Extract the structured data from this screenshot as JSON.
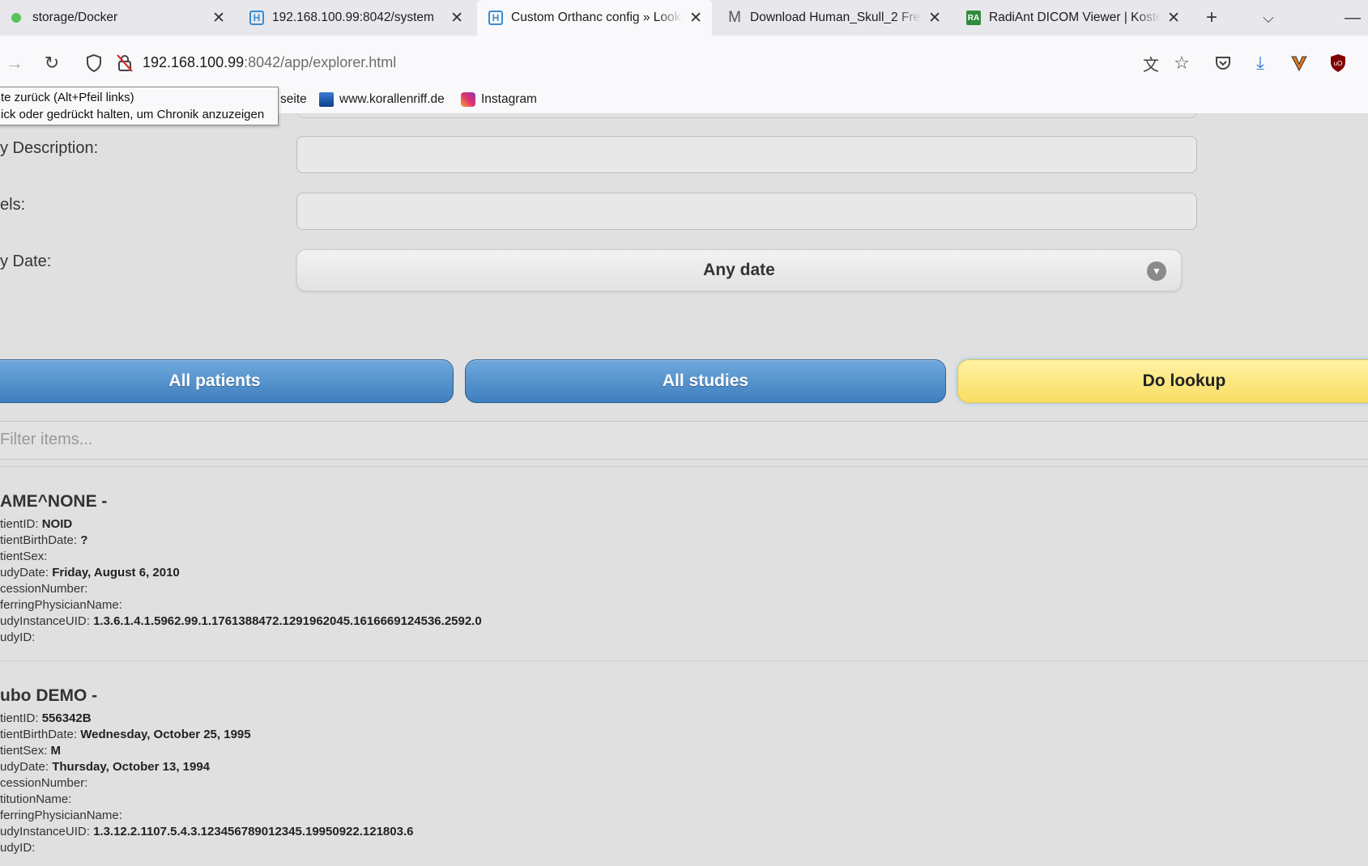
{
  "browser": {
    "tabs": [
      {
        "title": "storage/Docker",
        "favicon": "green-dot-icon"
      },
      {
        "title": "192.168.100.99:8042/system",
        "favicon": "orthanc-icon"
      },
      {
        "title": "Custom Orthanc config » Looku",
        "favicon": "orthanc-icon",
        "active": true
      },
      {
        "title": "Download Human_Skull_2 Free",
        "favicon": "m-icon"
      },
      {
        "title": "RadiAnt DICOM Viewer | Kosten",
        "favicon": "radiant-icon"
      }
    ],
    "url_host": "192.168.100.99",
    "url_rest": ":8042/app/explorer.html",
    "bookmarks": [
      {
        "label": "seite"
      },
      {
        "label": "www.korallenriff.de"
      },
      {
        "label": "Instagram"
      }
    ],
    "tooltip": {
      "line1": "te zurück (Alt+Pfeil links)",
      "line2": "ick oder gedrückt halten, um Chronik anzuzeigen"
    }
  },
  "form": {
    "description_label": "y Description:",
    "labels_label": "els:",
    "date_label": "y Date:",
    "date_value": "Any date"
  },
  "buttons": {
    "all_patients": "All patients",
    "all_studies": "All studies",
    "do_lookup": "Do lookup"
  },
  "filter": {
    "placeholder": "Filter items..."
  },
  "results": [
    {
      "name": "AME^NONE -",
      "fields": [
        {
          "key": "tientID:",
          "value": "NOID"
        },
        {
          "key": "tientBirthDate:",
          "value": "?"
        },
        {
          "key": "tientSex:",
          "value": ""
        },
        {
          "key": "udyDate:",
          "value": "Friday, August 6, 2010"
        },
        {
          "key": "cessionNumber:",
          "value": ""
        },
        {
          "key": "ferringPhysicianName:",
          "value": ""
        },
        {
          "key": "udyInstanceUID:",
          "value": "1.3.6.1.4.1.5962.99.1.1761388472.1291962045.1616669124536.2592.0"
        },
        {
          "key": "udyID:",
          "value": ""
        }
      ]
    },
    {
      "name": "ubo DEMO -",
      "fields": [
        {
          "key": "tientID:",
          "value": "556342B"
        },
        {
          "key": "tientBirthDate:",
          "value": "Wednesday, October 25, 1995"
        },
        {
          "key": "tientSex:",
          "value": "M"
        },
        {
          "key": "udyDate:",
          "value": "Thursday, October 13, 1994"
        },
        {
          "key": "cessionNumber:",
          "value": ""
        },
        {
          "key": "titutionName:",
          "value": ""
        },
        {
          "key": "ferringPhysicianName:",
          "value": ""
        },
        {
          "key": "udyInstanceUID:",
          "value": "1.3.12.2.1107.5.4.3.123456789012345.19950922.121803.6"
        },
        {
          "key": "udyID:",
          "value": ""
        }
      ]
    }
  ]
}
